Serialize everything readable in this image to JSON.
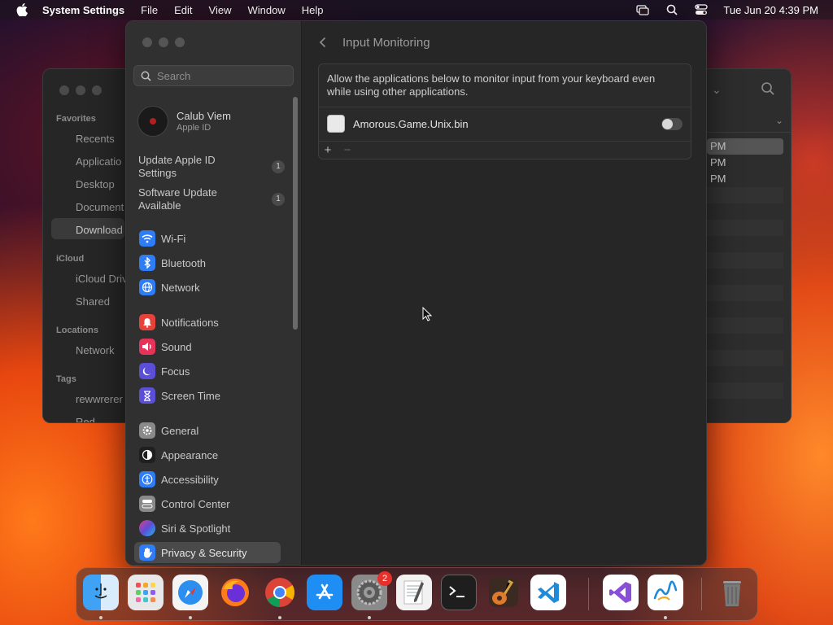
{
  "menubar": {
    "app_name": "System Settings",
    "items": [
      "File",
      "Edit",
      "View",
      "Window",
      "Help"
    ],
    "datetime": "Tue Jun 20  4:39 PM"
  },
  "finder": {
    "favorites_title": "Favorites",
    "favorites": [
      "Recents",
      "Applicatio",
      "Desktop",
      "Document",
      "Download"
    ],
    "icloud_title": "iCloud",
    "icloud": [
      "iCloud Driv",
      "Shared"
    ],
    "locations_title": "Locations",
    "locations": [
      "Network"
    ],
    "tags_title": "Tags",
    "tags": [
      "rewwrerer",
      "Red"
    ],
    "rows": [
      "PM",
      "PM",
      "PM"
    ]
  },
  "settings": {
    "search_placeholder": "Search",
    "profile": {
      "name": "Calub Viem",
      "sub": "Apple ID"
    },
    "notices": [
      {
        "label": "Update Apple ID Settings",
        "count": "1"
      },
      {
        "label": "Software Update Available",
        "count": "1"
      }
    ],
    "nav": [
      {
        "label": "Wi-Fi",
        "icon": "wifi-icon",
        "color": "#2f7df6"
      },
      {
        "label": "Bluetooth",
        "icon": "bluetooth-icon",
        "color": "#2f7df6"
      },
      {
        "label": "Network",
        "icon": "globe-icon",
        "color": "#2f7df6"
      },
      {
        "label": "Notifications",
        "icon": "bell-icon",
        "color": "#e5433a"
      },
      {
        "label": "Sound",
        "icon": "speaker-icon",
        "color": "#e5335a"
      },
      {
        "label": "Focus",
        "icon": "moon-icon",
        "color": "#5b4fd8"
      },
      {
        "label": "Screen Time",
        "icon": "hourglass-icon",
        "color": "#5b4fd8"
      },
      {
        "label": "General",
        "icon": "gear-icon",
        "color": "#8a8a8a"
      },
      {
        "label": "Appearance",
        "icon": "appearance-icon",
        "color": "#1f1f1f"
      },
      {
        "label": "Accessibility",
        "icon": "accessibility-icon",
        "color": "#2f7df6"
      },
      {
        "label": "Control Center",
        "icon": "control-center-icon",
        "color": "#8a8a8a"
      },
      {
        "label": "Siri & Spotlight",
        "icon": "siri-icon",
        "color": "#c23cc8"
      },
      {
        "label": "Privacy & Security",
        "icon": "hand-icon",
        "color": "#2f7df6"
      }
    ],
    "main": {
      "title": "Input Monitoring",
      "description": "Allow the applications below to monitor input from your keyboard even while using other applications.",
      "apps": [
        {
          "name": "Amorous.Game.Unix.bin",
          "enabled": false
        }
      ],
      "add_label": "+",
      "remove_label": "−"
    }
  },
  "dock": {
    "apps": [
      "Finder",
      "Launchpad",
      "Safari",
      "Firefox",
      "Chrome",
      "App Store",
      "System Settings",
      "TextEdit",
      "Terminal",
      "GarageBand",
      "Visual Studio Code",
      "Visual Studio",
      "Freeform",
      "Trash"
    ],
    "system_settings_badge": "2"
  }
}
